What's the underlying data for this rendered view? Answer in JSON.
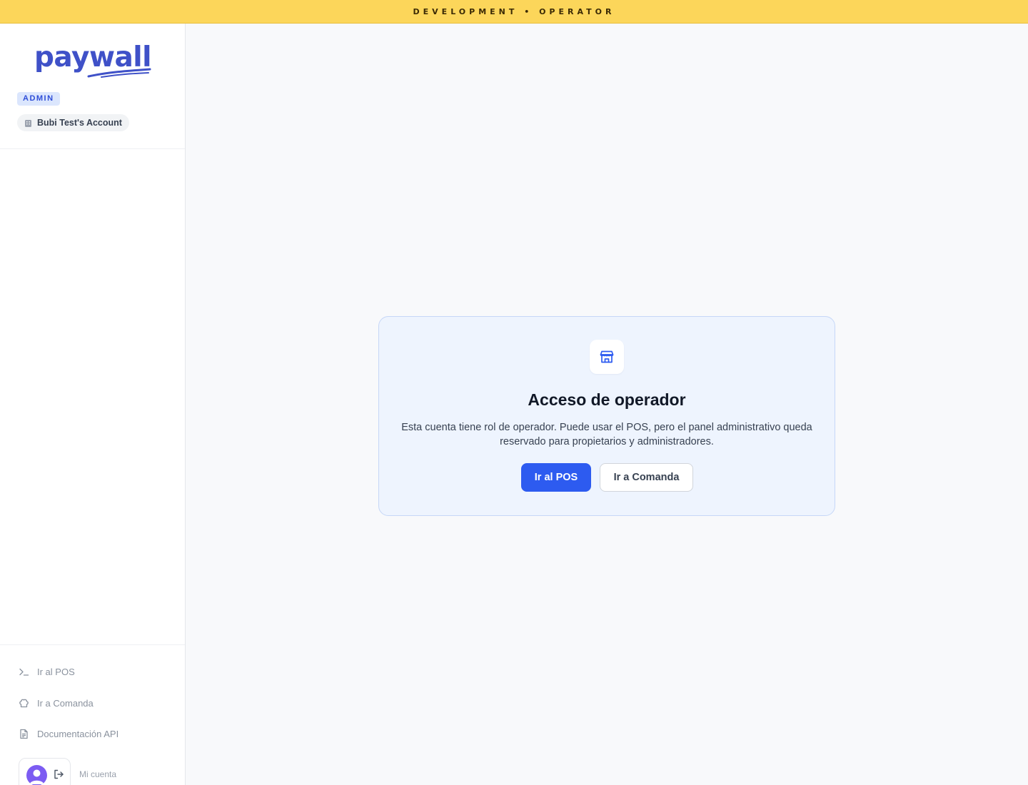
{
  "env_banner": {
    "text": "DEVELOPMENT • OPERATOR"
  },
  "sidebar": {
    "logo_text": "paywall",
    "role_badge": "ADMIN",
    "account_name": "Bubi Test's Account",
    "footer_items": [
      {
        "label": "Ir al POS",
        "icon": "terminal-icon"
      },
      {
        "label": "Ir a Comanda",
        "icon": "chef-hat-icon"
      },
      {
        "label": "Documentación API",
        "icon": "document-icon"
      }
    ],
    "user": {
      "my_account_label": "Mi cuenta"
    }
  },
  "card": {
    "icon": "store-icon",
    "title": "Acceso de operador",
    "description": "Esta cuenta tiene rol de operador. Puede usar el POS, pero el panel administrativo queda reservado para propietarios y administradores.",
    "primary_button": "Ir al POS",
    "secondary_button": "Ir a Comanda"
  },
  "colors": {
    "banner": "#fcd65a",
    "brand": "#3f51c8",
    "primary": "#2d5bf0",
    "card_bg": "#eef4fe"
  }
}
